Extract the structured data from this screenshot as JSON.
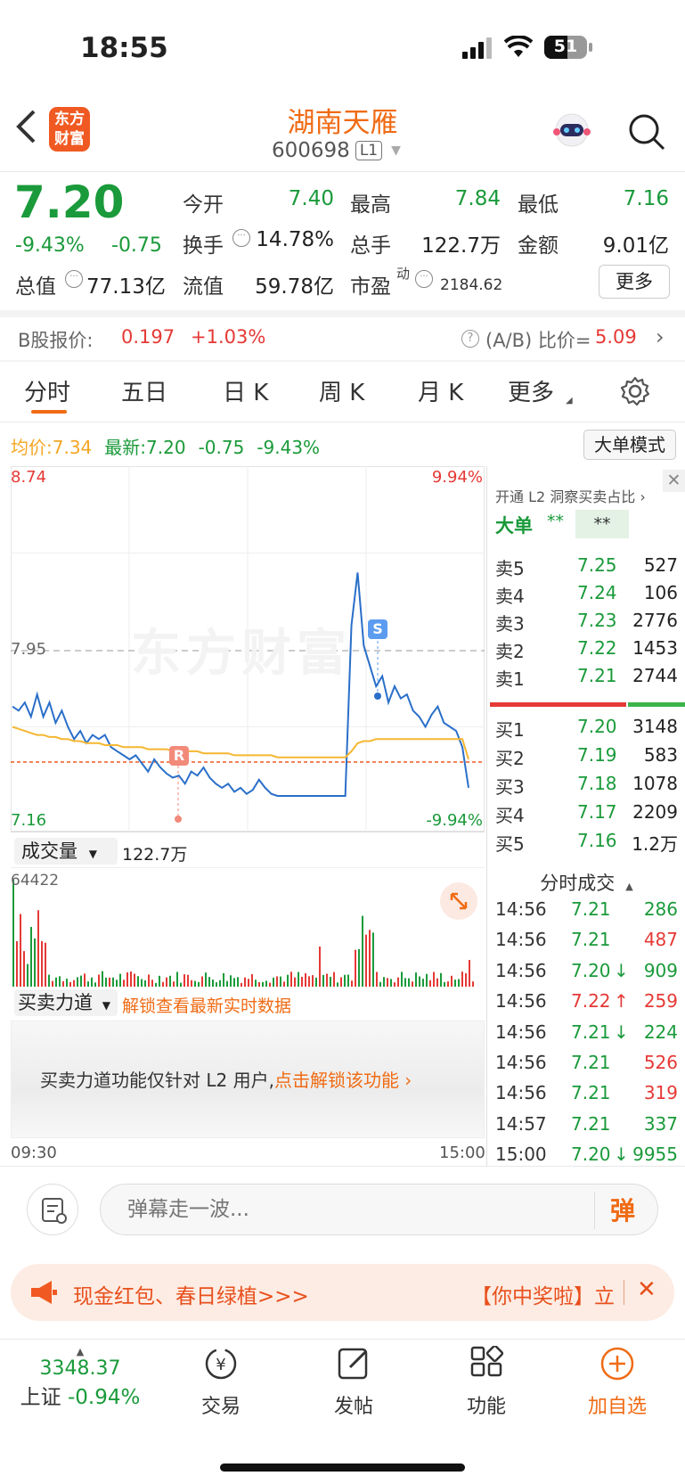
{
  "status_bar": {
    "time": "18:55",
    "battery": "51"
  },
  "header": {
    "logo_line1": "东方",
    "logo_line2": "财富",
    "title": "湖南天雁",
    "code": "600698",
    "level_badge": "L1"
  },
  "quote": {
    "price": "7.20",
    "change_pct": "-9.43%",
    "change": "-0.75",
    "open_label": "今开",
    "open": "7.40",
    "high_label": "最高",
    "high": "7.84",
    "low_label": "最低",
    "low": "7.16",
    "turnover_label": "换手",
    "turnover": "14.78%",
    "volume_label": "总手",
    "volume": "122.7万",
    "amount_label": "金额",
    "amount": "9.01亿",
    "mktcap_label": "总值",
    "mktcap": "77.13亿",
    "float_label": "流值",
    "float_cap": "59.78亿",
    "pe_label": "市盈",
    "pe_sup": "动",
    "pe": "2184.62",
    "more_button": "更多"
  },
  "bshare": {
    "label": "B股报价:",
    "price": "0.197",
    "change": "+1.03%",
    "ratio_label": "(A/B) 比价=",
    "ratio": "5.09"
  },
  "tabs": [
    "分时",
    "五日",
    "日 K",
    "周 K",
    "月 K",
    "更多"
  ],
  "chart_info": {
    "avg_label": "均价:",
    "avg": "7.34",
    "latest_label": "最新:",
    "latest": "7.20",
    "change": "-0.75",
    "change_pct": "-9.43%",
    "big_order_button": "大单模式"
  },
  "chart_data": {
    "type": "line",
    "y_top_label": "8.74",
    "y_top_pct": "9.94%",
    "y_ref_label": "7.95",
    "y_bottom_label": "7.16",
    "y_bottom_pct": "-9.94%",
    "ylim": [
      7.16,
      8.74
    ],
    "x_start": "09:30",
    "x_end": "15:00",
    "markers": [
      "R",
      "S"
    ],
    "watermark": "东方财富",
    "series": [
      {
        "values": [
          7.6,
          7.58,
          7.62,
          7.55,
          7.66,
          7.55,
          7.62,
          7.52,
          7.58,
          7.5,
          7.44,
          7.48,
          7.42,
          7.46,
          7.44,
          7.46,
          7.4,
          7.38,
          7.36,
          7.34,
          7.36,
          7.32,
          7.28,
          7.34,
          7.3,
          7.27,
          7.25,
          7.26,
          7.22,
          7.28,
          7.26,
          7.3,
          7.25,
          7.22,
          7.2,
          7.22,
          7.18,
          7.2,
          7.17,
          7.19,
          7.24,
          7.2,
          7.17,
          7.16,
          7.16,
          7.16,
          7.16,
          7.16,
          7.16,
          7.16,
          7.16,
          7.16,
          7.16,
          7.16,
          7.16,
          8.0,
          8.26,
          7.9,
          7.8,
          7.7,
          7.75,
          7.62,
          7.7,
          7.64,
          7.66,
          7.58,
          7.55,
          7.5,
          7.56,
          7.6,
          7.52,
          7.5,
          7.48,
          7.4,
          7.2
        ]
      },
      {
        "values": [
          7.5,
          7.49,
          7.48,
          7.47,
          7.46,
          7.46,
          7.45,
          7.45,
          7.44,
          7.44,
          7.43,
          7.43,
          7.42,
          7.42,
          7.42,
          7.41,
          7.41,
          7.41,
          7.4,
          7.4,
          7.4,
          7.4,
          7.39,
          7.39,
          7.39,
          7.39,
          7.38,
          7.38,
          7.38,
          7.38,
          7.38,
          7.37,
          7.37,
          7.37,
          7.37,
          7.37,
          7.36,
          7.36,
          7.36,
          7.36,
          7.36,
          7.36,
          7.36,
          7.35,
          7.35,
          7.35,
          7.35,
          7.35,
          7.35,
          7.35,
          7.35,
          7.35,
          7.35,
          7.35,
          7.35,
          7.38,
          7.42,
          7.43,
          7.43,
          7.44,
          7.44,
          7.44,
          7.44,
          7.44,
          7.44,
          7.44,
          7.44,
          7.44,
          7.44,
          7.44,
          7.44,
          7.44,
          7.44,
          7.44,
          7.34
        ]
      }
    ]
  },
  "volume": {
    "label": "成交量",
    "total": "122.7万",
    "max": "64422"
  },
  "power": {
    "label": "买卖力道",
    "unlock_text": "解锁查看最新实时数据",
    "note": "买卖力道功能仅针对 L2 用户,",
    "note_link": "点击解锁该功能"
  },
  "side": {
    "l2_text": "开通 L2 洞察买卖占比",
    "big_label": "大单",
    "big_val1": "**",
    "big_val2": "**",
    "asks": [
      {
        "label": "卖5",
        "price": "7.25",
        "vol": "527"
      },
      {
        "label": "卖4",
        "price": "7.24",
        "vol": "106"
      },
      {
        "label": "卖3",
        "price": "7.23",
        "vol": "2776"
      },
      {
        "label": "卖2",
        "price": "7.22",
        "vol": "1453"
      },
      {
        "label": "卖1",
        "price": "7.21",
        "vol": "2744"
      }
    ],
    "bids": [
      {
        "label": "买1",
        "price": "7.20",
        "vol": "3148"
      },
      {
        "label": "买2",
        "price": "7.19",
        "vol": "583"
      },
      {
        "label": "买3",
        "price": "7.18",
        "vol": "1078"
      },
      {
        "label": "买4",
        "price": "7.17",
        "vol": "2209"
      },
      {
        "label": "买5",
        "price": "7.16",
        "vol": "1.2万"
      }
    ],
    "trades_label": "分时成交",
    "trades": [
      {
        "time": "14:56",
        "price": "7.21",
        "arrow": "",
        "vol": "286",
        "vol_color": "green"
      },
      {
        "time": "14:56",
        "price": "7.21",
        "arrow": "",
        "vol": "487",
        "vol_color": "red"
      },
      {
        "time": "14:56",
        "price": "7.20",
        "arrow": "↓",
        "vol": "909",
        "vol_color": "green"
      },
      {
        "time": "14:56",
        "price": "7.22",
        "arrow": "↑",
        "vol": "259",
        "vol_color": "red"
      },
      {
        "time": "14:56",
        "price": "7.21",
        "arrow": "↓",
        "vol": "224",
        "vol_color": "green"
      },
      {
        "time": "14:56",
        "price": "7.21",
        "arrow": "",
        "vol": "526",
        "vol_color": "red"
      },
      {
        "time": "14:56",
        "price": "7.21",
        "arrow": "",
        "vol": "319",
        "vol_color": "red"
      },
      {
        "time": "14:57",
        "price": "7.21",
        "arrow": "",
        "vol": "337",
        "vol_color": "green"
      },
      {
        "time": "15:00",
        "price": "7.20",
        "arrow": "↓",
        "vol": "9955",
        "vol_color": "green"
      }
    ]
  },
  "comment": {
    "placeholder": "弹幕走一波...",
    "send_button": "弹"
  },
  "banner": {
    "text": "现金红包、春日绿植>>>",
    "right_text": "【你中奖啦】立"
  },
  "bottom_nav": {
    "index_value": "3348.37",
    "index_name": "上证",
    "index_change": "-0.94%",
    "trade": "交易",
    "post": "发帖",
    "function": "功能",
    "add_watch": "加自选"
  }
}
